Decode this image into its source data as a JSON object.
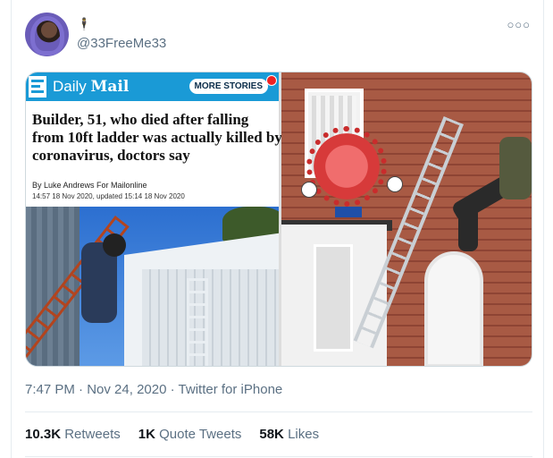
{
  "tweet": {
    "display_name_glyph": "🕴",
    "handle": "@33FreeMe33",
    "more_icon": "ellipsis-icon"
  },
  "media": {
    "left_panel": {
      "brand_light": "Daily",
      "brand_bold": "Mail",
      "more_stories_label": "MORE STORIES",
      "headline": "Builder, 51, who died after falling from 10ft ladder was actually killed by coronavirus, doctors say",
      "byline": "By Luke Andrews For Mailonline",
      "dateline": "14:57 18 Nov 2020, updated 15:14 18 Nov 2020"
    }
  },
  "meta": {
    "time": "7:47 PM",
    "separator": "·",
    "date": "Nov 24, 2020",
    "source": "Twitter for iPhone"
  },
  "stats": {
    "retweets_count": "10.3K",
    "retweets_label": "Retweets",
    "quote_count": "1K",
    "quote_label": "Quote Tweets",
    "likes_count": "58K",
    "likes_label": "Likes"
  },
  "colors": {
    "secondary_text": "#5b7083",
    "daily_mail_blue": "#1a9ad6"
  }
}
